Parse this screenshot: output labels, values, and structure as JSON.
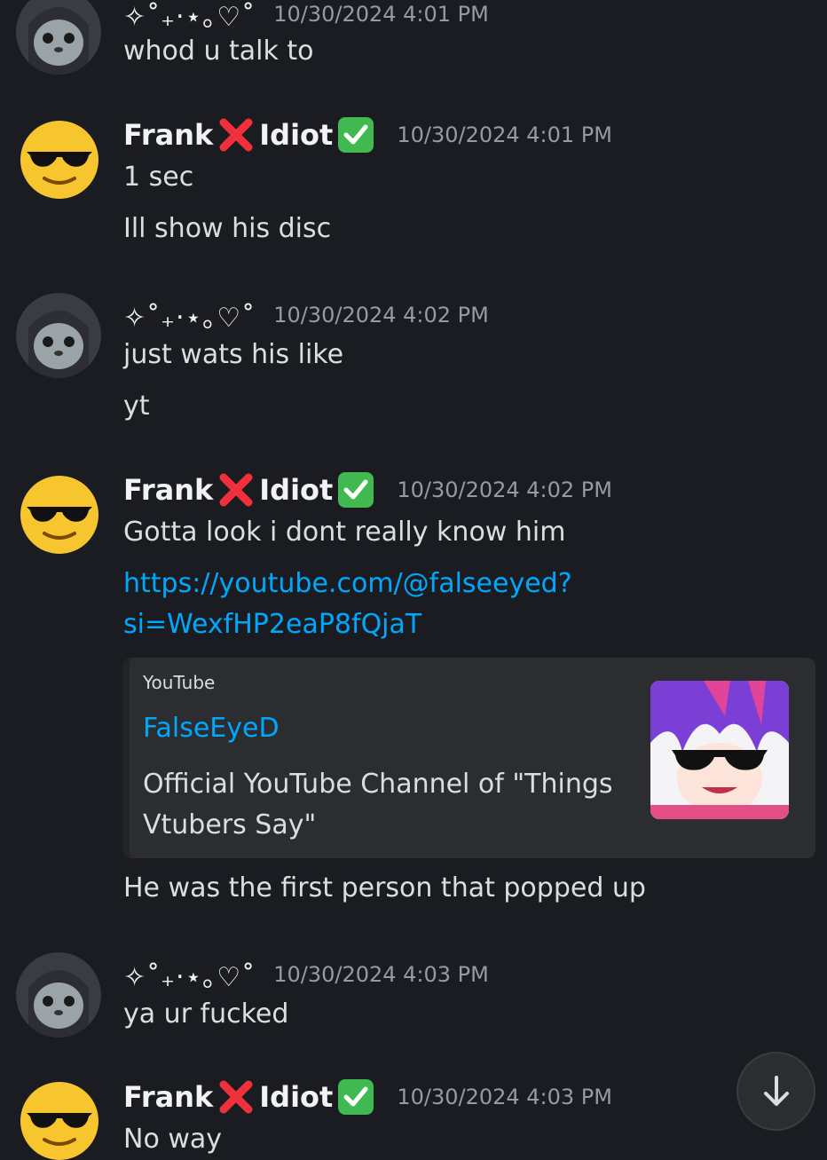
{
  "users": {
    "seal": {
      "name": "✧˚₊‧⋆｡♡˚"
    },
    "frank": {
      "name_part1": "Frank",
      "name_part2": "Idiot"
    }
  },
  "messages": [
    {
      "author": "seal",
      "timestamp": "10/30/2024 4:01 PM",
      "lines": [
        "whod u talk to"
      ]
    },
    {
      "author": "frank",
      "timestamp": "10/30/2024 4:01 PM",
      "lines": [
        "1 sec",
        "Ill show his disc"
      ]
    },
    {
      "author": "seal",
      "timestamp": "10/30/2024 4:02 PM",
      "lines": [
        "just wats his like",
        "yt"
      ]
    },
    {
      "author": "frank",
      "timestamp": "10/30/2024 4:02 PM",
      "lines": [
        "Gotta look i dont really know him"
      ],
      "link_line1": "https://youtube.com/@falseeyed?",
      "link_line2": "si=WexfHP2eaP8fQjaT",
      "after_embed": "He was the first person that popped up"
    },
    {
      "author": "seal",
      "timestamp": "10/30/2024 4:03 PM",
      "lines": [
        "ya ur fucked"
      ]
    },
    {
      "author": "frank",
      "timestamp": "10/30/2024 4:03 PM",
      "lines": [
        "No way"
      ]
    }
  ],
  "embed": {
    "provider": "YouTube",
    "title": "FalseEyeD",
    "description": "Official YouTube Channel of \"Things Vtubers Say\""
  },
  "colors": {
    "background": "#1b1c21",
    "link": "#00a8fc",
    "embed_bg": "#2b2d31",
    "timestamp": "#949ba4"
  },
  "icons": {
    "jump_button": "arrow-down-icon",
    "badge_x": "cross-mark-icon",
    "badge_check": "check-mark-icon"
  }
}
